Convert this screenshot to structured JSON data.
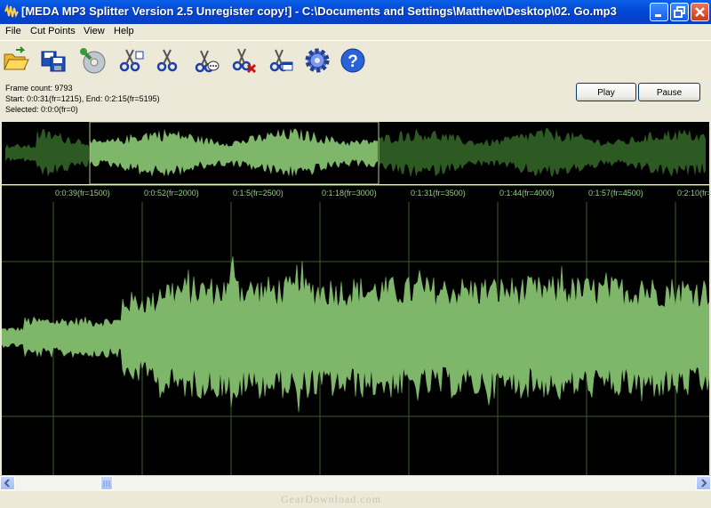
{
  "window": {
    "title": "[MEDA MP3 Splitter Version 2.5 Unregister copy!] - C:\\Documents and Settings\\Matthew\\Desktop\\02. Go.mp3",
    "icon": "waveform-app-icon"
  },
  "menu": [
    "File",
    "Cut Points",
    "View",
    "Help"
  ],
  "toolbar": [
    "open-folder-icon",
    "save-icon",
    "cd-icon",
    "split-scissors-icon",
    "scissors-icon",
    "scissors-arrow-icon",
    "scissors-comment-icon",
    "scissors-delete-icon",
    "scissors-window-icon",
    "settings-gear-icon",
    "help-icon"
  ],
  "info": {
    "frame_count": "Frame count: 9793",
    "range": "Start: 0:0:31(fr=1215), End: 0:2:15(fr=5195)",
    "selected": "Selected: 0:0:0(fr=0)"
  },
  "buttons": {
    "play": "Play",
    "pause": "Pause"
  },
  "timeline": {
    "ticks": [
      "0:0:39(fr=1500)",
      "0:0:52(fr=2000)",
      "0:1:5(fr=2500)",
      "0:1:18(fr=3000)",
      "0:1:31(fr=3500)",
      "0:1:44(fr=4000)",
      "0:1:57(fr=4500)",
      "0:2:10(fr="
    ]
  },
  "watermark": "GearDownload.com",
  "colors": {
    "wave": "#7eb66a",
    "wave_dim": "#2d5a22",
    "grid": "#3e5c2c",
    "titlebar": "#0a5fe6"
  }
}
